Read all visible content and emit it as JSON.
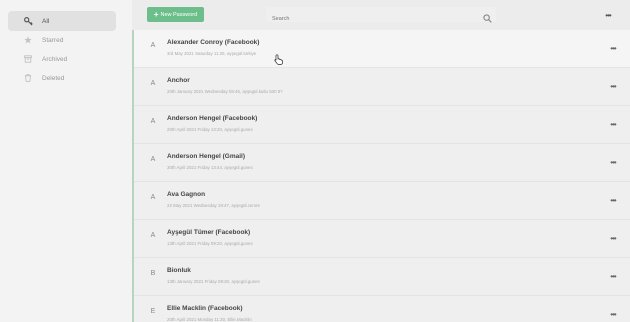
{
  "sidebar": {
    "items": [
      {
        "label": "All",
        "icon": "key-icon",
        "active": true
      },
      {
        "label": "Starred",
        "icon": "star-icon"
      },
      {
        "label": "Archived",
        "icon": "archive-icon"
      },
      {
        "label": "Deleted",
        "icon": "trash-icon"
      }
    ]
  },
  "toolbar": {
    "new_password_label": "New Password",
    "search_placeholder": "Search",
    "more_label": "•••"
  },
  "entries": [
    {
      "letter": "A",
      "title": "Alexander Conroy (Facebook)",
      "meta": "3rd May 2021 Saturday 11:26, ayşegül.türkiye",
      "more": "•••"
    },
    {
      "letter": "A",
      "title": "Anchor",
      "meta": "20th January 2021 Wednesday 08:46, ayşegül.kutlu 530 5?",
      "more": "•••"
    },
    {
      "letter": "A",
      "title": "Anderson Hengel (Facebook)",
      "meta": "20th April 2021 Friday 13:20, ayşegül.gunes",
      "more": "•••"
    },
    {
      "letter": "A",
      "title": "Anderson Hengel (Gmail)",
      "meta": "30th April 2021 Friday 13:44, ayşegül.gunes",
      "more": "•••"
    },
    {
      "letter": "A",
      "title": "Ava Gagnon",
      "meta": "22 May 2021 Wednesday 19:47, ayşegül.cemre",
      "more": "•••"
    },
    {
      "letter": "A",
      "title": "Ayşegül Tümer (Facebook)",
      "meta": "13th April 2021 Friday 09:20, ayşegül.gunes",
      "more": "•••"
    },
    {
      "letter": "B",
      "title": "Bionluk",
      "meta": "13th January 2021 Friday 08:20, ayşegül.gunes",
      "more": "•••"
    },
    {
      "letter": "E",
      "title": "Ellie Macklin (Facebook)",
      "meta": "20th April 2021 Monday 11:30, Ellie.Macklin",
      "more": "•••"
    }
  ]
}
